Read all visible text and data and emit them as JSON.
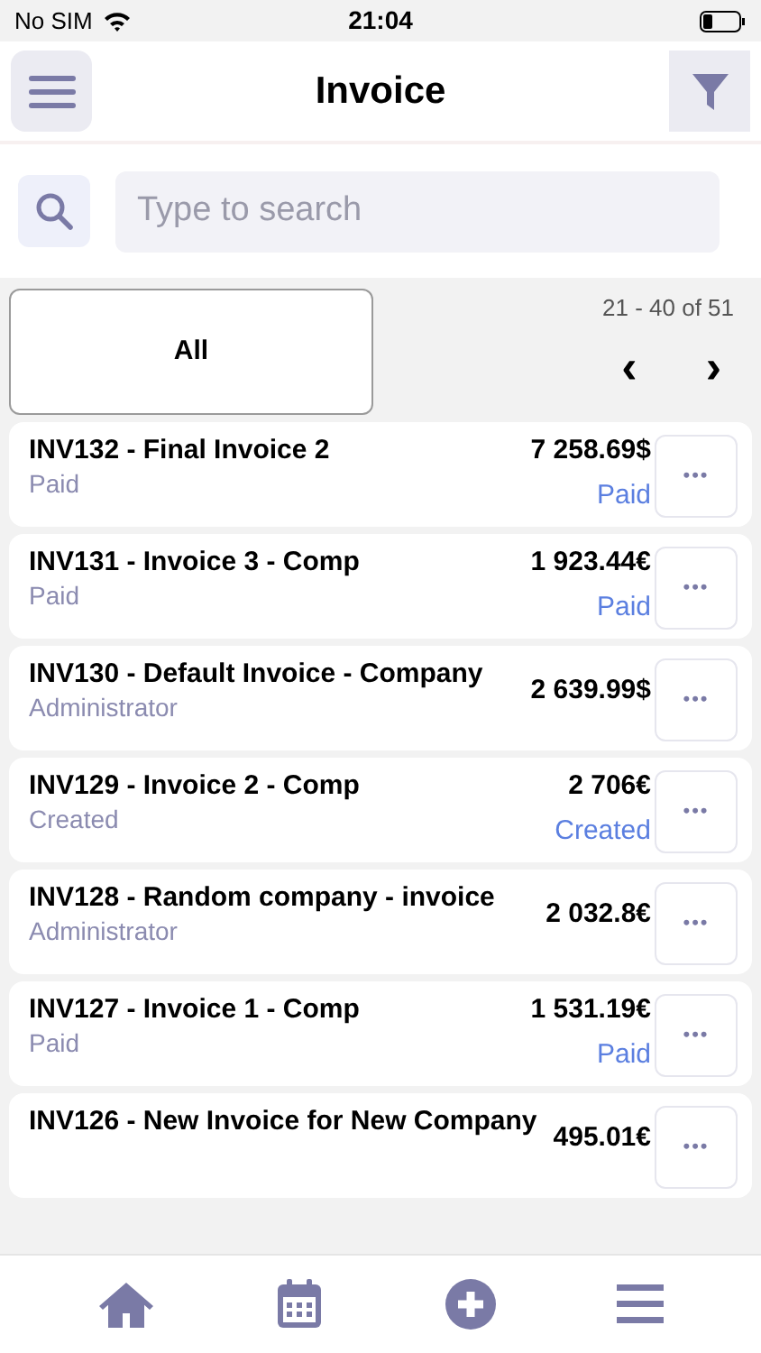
{
  "status_bar": {
    "carrier": "No SIM",
    "time": "21:04"
  },
  "header": {
    "title": "Invoice"
  },
  "search": {
    "placeholder": "Type to search"
  },
  "filter_tab": {
    "label": "All",
    "selected": true
  },
  "pagination": {
    "range": "21 - 40 of 51",
    "prev": "‹",
    "next": "›"
  },
  "invoices": [
    {
      "title": "INV132 - Final Invoice 2",
      "subtitle": "Paid",
      "amount": "7 258.69$",
      "status": "Paid",
      "more": "•••"
    },
    {
      "title": "INV131 - Invoice 3 - Comp",
      "subtitle": "Paid",
      "amount": "1 923.44€",
      "status": "Paid",
      "more": "•••"
    },
    {
      "title": "INV130 - Default Invoice - Company",
      "subtitle": "Administrator",
      "amount": "2 639.99$",
      "more": "•••"
    },
    {
      "title": "INV129 - Invoice 2 - Comp",
      "subtitle": "Created",
      "amount": "2 706€",
      "status": "Created",
      "more": "•••"
    },
    {
      "title": "INV128 - Random company - invoice",
      "subtitle": "Administrator",
      "amount": "2 032.8€",
      "more": "•••"
    },
    {
      "title": "INV127 - Invoice 1 - Comp",
      "subtitle": "Paid",
      "amount": "1 531.19€",
      "status": "Paid",
      "more": "•••"
    },
    {
      "title": "INV126 - New Invoice for New Company",
      "amount": "495.01€",
      "more": "•••"
    }
  ]
}
